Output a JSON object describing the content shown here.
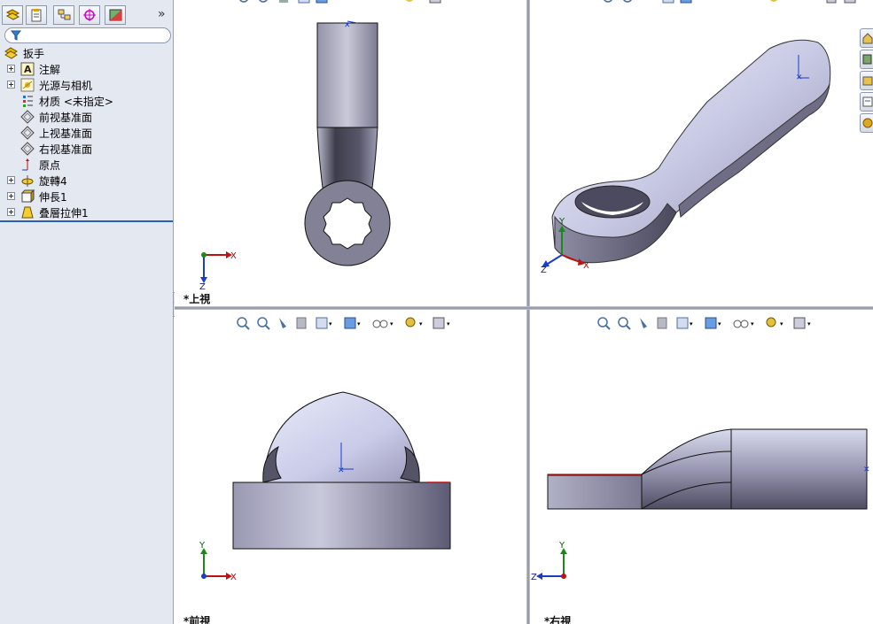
{
  "sidebar": {
    "more": "»",
    "tabs": [
      "feature-manager-icon",
      "property-manager-icon",
      "configuration-manager-icon",
      "dimxpert-icon",
      "display-manager-icon"
    ],
    "tree": [
      {
        "label": "扳手",
        "icon": "part-icon",
        "expander": false
      },
      {
        "label": "注解",
        "icon": "annotations-icon",
        "expander": true
      },
      {
        "label": "光源与相机",
        "icon": "lights-cameras-icon",
        "expander": true
      },
      {
        "label": "材质 <未指定>",
        "icon": "material-icon",
        "expander": false
      },
      {
        "label": "前视基准面",
        "icon": "plane-icon",
        "expander": false
      },
      {
        "label": "上视基准面",
        "icon": "plane-icon",
        "expander": false
      },
      {
        "label": "右视基准面",
        "icon": "plane-icon",
        "expander": false
      },
      {
        "label": "原点",
        "icon": "origin-icon",
        "expander": false
      },
      {
        "label": "旋轉4",
        "icon": "revolve-icon",
        "expander": true
      },
      {
        "label": "伸長1",
        "icon": "extrude-icon",
        "expander": true
      },
      {
        "label": "叠層拉伸1",
        "icon": "loft-icon",
        "expander": true
      }
    ]
  },
  "viewports": {
    "top": {
      "label": "*上視"
    },
    "front": {
      "label": "*前視"
    },
    "right": {
      "label": "*右視"
    }
  },
  "axes": {
    "x": "X",
    "y": "Y",
    "z": "Z"
  },
  "colors": {
    "accent": "#2a5fb5",
    "part_light": "#dcdff5",
    "part_dark": "#5c5a73",
    "edge": "#1a1a1a"
  }
}
